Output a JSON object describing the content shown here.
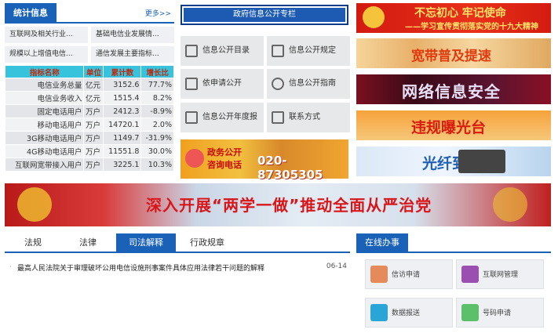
{
  "stats": {
    "title": "统计信息",
    "more": "更多>>",
    "quick_links": [
      "互联网及相关行业...",
      "基础电信业发展情...",
      "规模以上增值电信...",
      "通信发展主要指标..."
    ],
    "headers": [
      "指标名称",
      "单位",
      "累计数",
      "增长比"
    ],
    "rows": [
      [
        "电信业务总量",
        "亿元",
        "3152.6",
        "77.7%"
      ],
      [
        "电信业务收入",
        "亿元",
        "1515.4",
        "8.2%"
      ],
      [
        "固定电话用户",
        "万户",
        "2412.3",
        "-8.9%"
      ],
      [
        "移动电话用户",
        "万户",
        "14720.1",
        "2.0%"
      ],
      [
        "3G移动电话用户",
        "万户",
        "1149.7",
        "-31.9%"
      ],
      [
        "4G移动电话用户",
        "万户",
        "11551.8",
        "30.0%"
      ],
      [
        "互联网宽带接入用户",
        "万户",
        "3225.1",
        "10.3%"
      ]
    ]
  },
  "gov": {
    "header": "政府信息公开专栏",
    "items": [
      "信息公开目录",
      "信息公开规定",
      "依申请公开",
      "信息公开指南",
      "信息公开年度报告",
      "联系方式"
    ]
  },
  "hotline": {
    "line1": "政务公开",
    "line2": "咨询电话",
    "number": "020-87305305"
  },
  "banners": {
    "b1_main": "不忘初心 牢记使命",
    "b1_sub": "——学习宣传贯彻落实党的十九大精神",
    "b2": "宽带普及提速",
    "b3": "网络信息安全",
    "b4": "违规曝光台",
    "b5": "光纤到户",
    "wide": "深入开展“两学一做”推动全面从严治党"
  },
  "tabs": [
    "法规",
    "法律",
    "司法解释",
    "行政规章"
  ],
  "news": {
    "bullet": "·",
    "title": "最高人民法院关于审理破坏公用电信设施刑事案件具体应用法律若干问题的解释",
    "date": "06-14"
  },
  "online": {
    "title": "在线办事",
    "items": [
      "信访申请",
      "互联网管理",
      "数据报送",
      "号码申请"
    ]
  },
  "colors": {
    "primary": "#1a62b8",
    "table_head": "#38c3dd",
    "table_head_text": "#c2280c"
  }
}
